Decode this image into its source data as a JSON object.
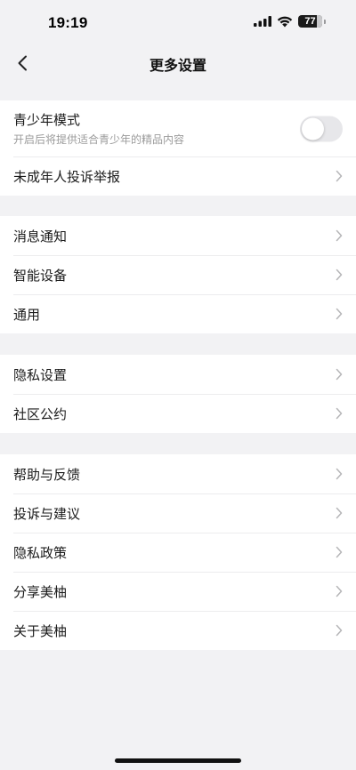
{
  "status_bar": {
    "time": "19:19",
    "battery": "77"
  },
  "nav": {
    "title": "更多设置"
  },
  "groups": [
    {
      "youth_mode": {
        "label": "青少年模式",
        "sublabel": "开启后将提供适合青少年的精品内容",
        "enabled": false
      },
      "items": [
        {
          "label": "未成年人投诉举报"
        }
      ]
    },
    {
      "items": [
        {
          "label": "消息通知"
        },
        {
          "label": "智能设备"
        },
        {
          "label": "通用"
        }
      ]
    },
    {
      "items": [
        {
          "label": "隐私设置"
        },
        {
          "label": "社区公约"
        }
      ]
    },
    {
      "items": [
        {
          "label": "帮助与反馈"
        },
        {
          "label": "投诉与建议"
        },
        {
          "label": "隐私政策"
        },
        {
          "label": "分享美柚"
        },
        {
          "label": "关于美柚"
        }
      ]
    }
  ],
  "colors": {
    "background": "#f2f2f4",
    "card": "#ffffff",
    "toggle_off": "#e7e7ea",
    "chevron": "#b6b6b8",
    "sublabel": "#9b9b9b"
  }
}
